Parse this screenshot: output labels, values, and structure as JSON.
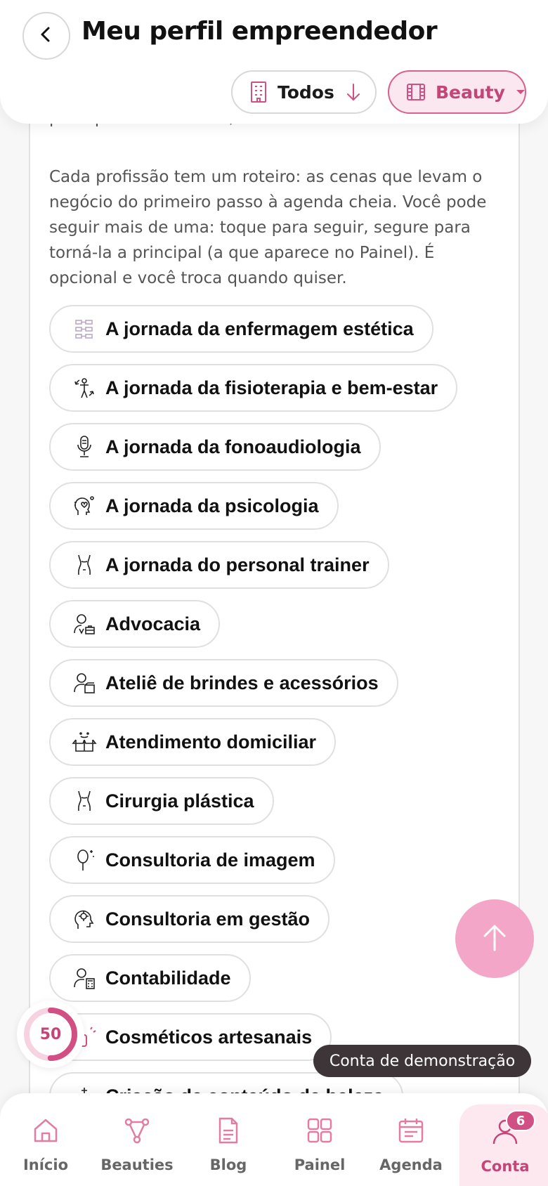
{
  "header": {
    "title": "Meu perfil empreendedor",
    "filter_all_label": "Todos",
    "filter_category_label": "Beauty"
  },
  "intro": {
    "partial_line": "pelo que você marcou, e você só confirma ou troca.",
    "paragraph": "Cada profissão tem um roteiro: as cenas que levam o negócio do primeiro passo à agenda cheia. Você pode seguir mais de uma: toque para seguir, segure para torná-la a principal (a que aparece no Painel). É opcional e você troca quando quiser."
  },
  "professions": [
    {
      "label": "A jornada da enfermagem estética",
      "icon": "flowchart-icon"
    },
    {
      "label": "A jornada da fisioterapia e bem-estar",
      "icon": "body-rotation-icon"
    },
    {
      "label": "A jornada da fonoaudiologia",
      "icon": "microphone-icon"
    },
    {
      "label": "A jornada da psicologia",
      "icon": "head-heart-icon"
    },
    {
      "label": "A jornada do personal trainer",
      "icon": "torso-icon"
    },
    {
      "label": "Advocacia",
      "icon": "lawyer-icon"
    },
    {
      "label": "Ateliê de brindes e acessórios",
      "icon": "person-box-icon"
    },
    {
      "label": "Atendimento domiciliar",
      "icon": "open-box-icon"
    },
    {
      "label": "Cirurgia plástica",
      "icon": "torso-icon"
    },
    {
      "label": "Consultoria de imagem",
      "icon": "mirror-icon"
    },
    {
      "label": "Consultoria em gestão",
      "icon": "head-gear-icon"
    },
    {
      "label": "Contabilidade",
      "icon": "person-calculator-icon"
    },
    {
      "label": "Cosméticos artesanais",
      "icon": "cosmetics-icon"
    },
    {
      "label": "Criação de conteúdo de beleza",
      "icon": "sparkle-icon"
    }
  ],
  "progress": {
    "value": "50",
    "fraction": 0.5
  },
  "demo_label": "Conta de demonstração",
  "nav": {
    "items": [
      {
        "label": "Início",
        "icon": "home-icon"
      },
      {
        "label": "Beauties",
        "icon": "network-icon"
      },
      {
        "label": "Blog",
        "icon": "document-icon"
      },
      {
        "label": "Painel",
        "icon": "grid-icon"
      },
      {
        "label": "Agenda",
        "icon": "calendar-icon"
      },
      {
        "label": "Conta",
        "icon": "account-icon"
      }
    ],
    "account_badge": "6",
    "active": "Conta"
  },
  "colors": {
    "accent": "#c44577",
    "accent_light": "#fbe7ef",
    "scroll_button": "#f4a6c8",
    "demo_pill": "#3d3538"
  }
}
